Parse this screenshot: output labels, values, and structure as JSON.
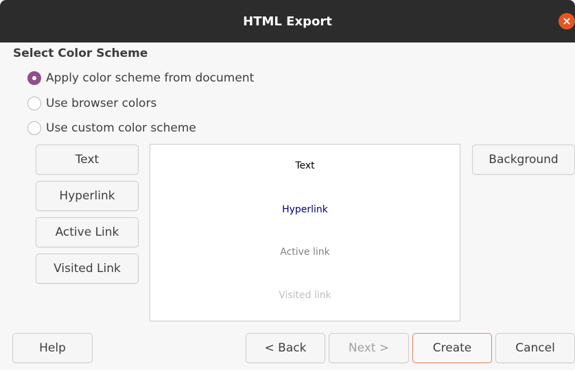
{
  "window": {
    "title": "HTML Export",
    "close_glyph": "×",
    "titlebar_color": "#2c2c2c",
    "close_color": "#e95420"
  },
  "section": {
    "title": "Select Color Scheme"
  },
  "radios": [
    {
      "label": "Apply color scheme from document",
      "checked": true
    },
    {
      "label": "Use browser colors",
      "checked": false
    },
    {
      "label": "Use custom color scheme",
      "checked": false
    }
  ],
  "color_buttons": {
    "text": "Text",
    "hyperlink": "Hyperlink",
    "active_link": "Active Link",
    "visited_link": "Visited Link",
    "background": "Background"
  },
  "preview": {
    "text": "Text",
    "hyperlink": "Hyperlink",
    "active_link": "Active link",
    "visited_link": "Visited link",
    "colors": {
      "text": "#000000",
      "hyperlink": "#000080",
      "active_link": "#808080",
      "visited_link": "#c0c0c0"
    }
  },
  "footer": {
    "help": "Help",
    "back": "< Back",
    "next": "Next >",
    "create": "Create",
    "cancel": "Cancel"
  },
  "accent_color": "#924d8b"
}
